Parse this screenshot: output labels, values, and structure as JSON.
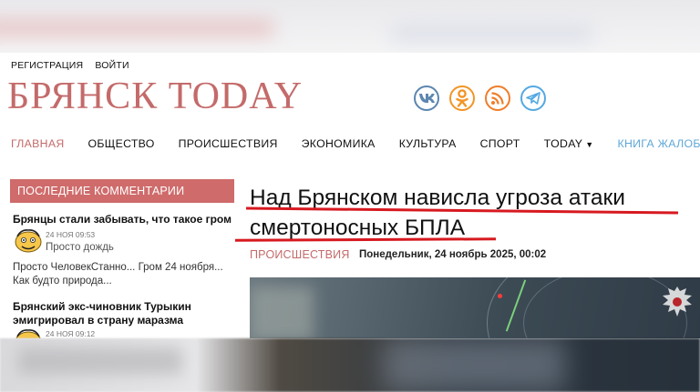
{
  "auth": {
    "register": "РЕГИСТРАЦИЯ",
    "login": "ВОЙТИ"
  },
  "site": {
    "logo": "БРЯНСК TODAY"
  },
  "socials": [
    {
      "name": "vk",
      "label": "VK",
      "color": "#5b86b0"
    },
    {
      "name": "odnoklassniki",
      "color": "#f29526"
    },
    {
      "name": "rss",
      "color": "#ef7d2a"
    },
    {
      "name": "telegram",
      "color": "#54a9e2"
    }
  ],
  "nav": {
    "items": [
      "ГЛАВНАЯ",
      "ОБЩЕСТВО",
      "ПРОИСШЕСТВИЯ",
      "ЭКОНОМИКА",
      "КУЛЬТУРА",
      "СПОРТ",
      "TODAY",
      "КНИГА ЖАЛОБ"
    ],
    "active_color": "#c46a6a",
    "link_color": "#5fa7d6"
  },
  "sidebar": {
    "heading": "ПОСЛЕДНИЕ КОММЕНТАРИИ",
    "comments": [
      {
        "title": "Брянцы стали забывать, что такое гром",
        "date": "24 НОЯ 09:53",
        "author_text": "Просто дождь",
        "body": "Просто ЧеловекСтанно... Гром 24 ноября... Как будто природа..."
      },
      {
        "title": "Брянский экс-чиновник Турыкин эмигрировал в страну маразма",
        "date": "24 НОЯ 09:12"
      }
    ]
  },
  "article": {
    "title_line1": "Над Брянском нависла угроза атаки",
    "title_line2": "смертоносных БПЛА",
    "category": "ПРОИСШЕСТВИЯ",
    "date": "Понедельник, 24 ноябрь 2025, 00:02",
    "underline_color": "#d71920"
  }
}
